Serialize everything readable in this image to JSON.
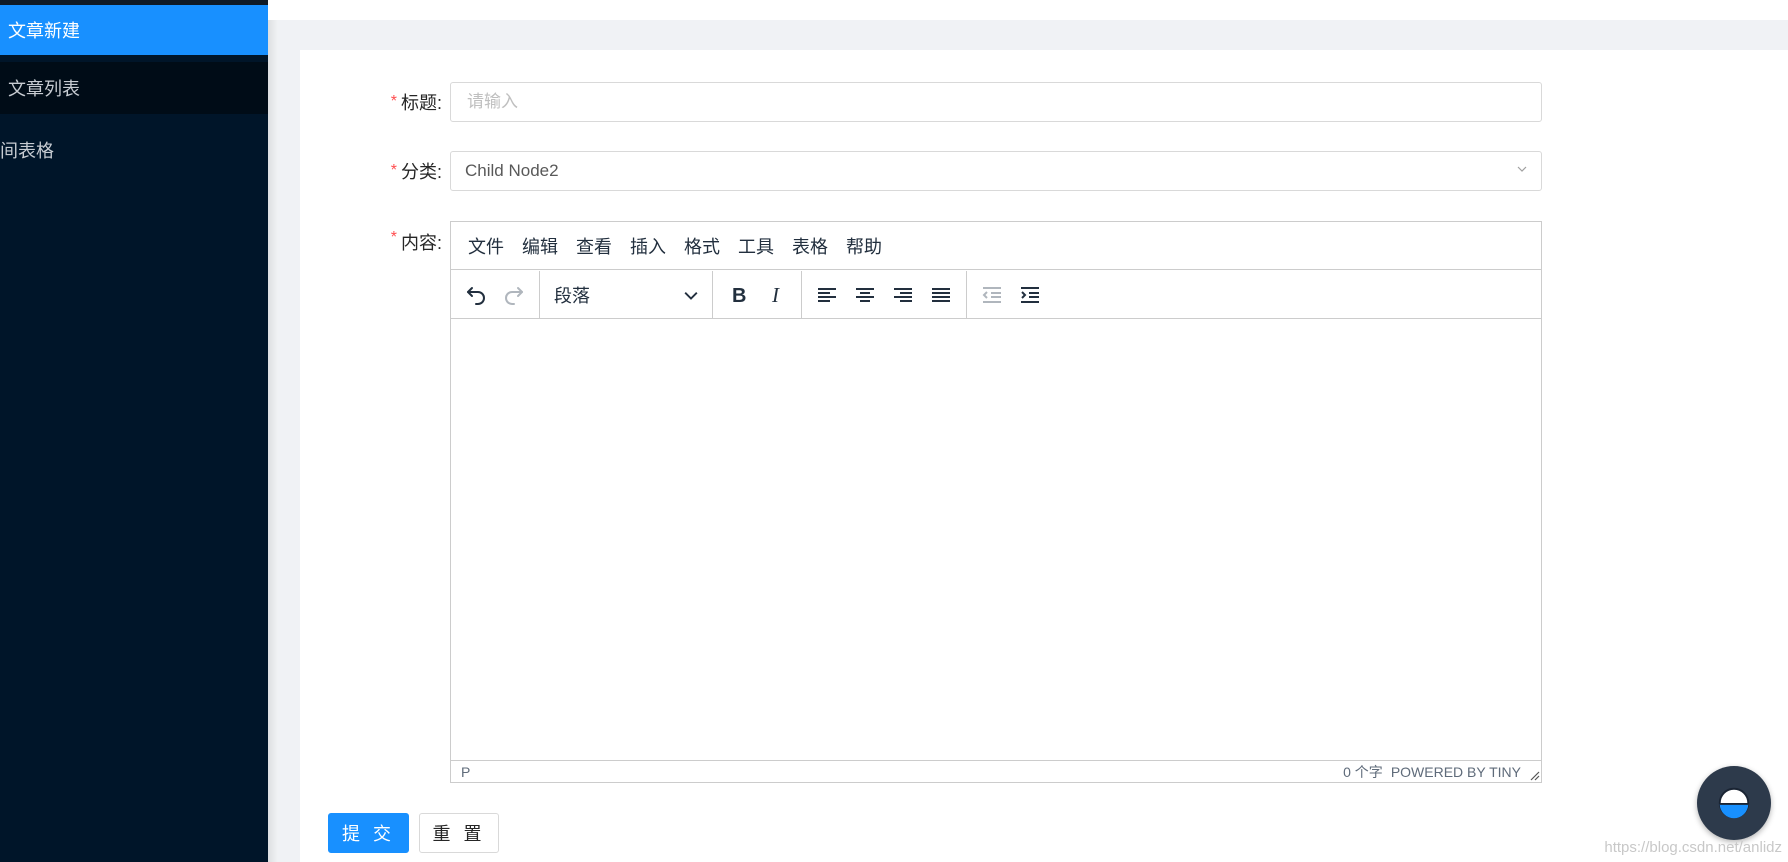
{
  "sidebar": {
    "items": [
      {
        "label": "文章新建",
        "active": true
      },
      {
        "label": "文章列表",
        "active": false
      },
      {
        "label": "间表格",
        "active": false
      }
    ]
  },
  "form": {
    "title": {
      "label": "标题:",
      "placeholder": "请输入",
      "value": ""
    },
    "category": {
      "label": "分类:",
      "value": "Child Node2"
    },
    "content": {
      "label": "内容:"
    }
  },
  "editor": {
    "menu": [
      "文件",
      "编辑",
      "查看",
      "插入",
      "格式",
      "工具",
      "表格",
      "帮助"
    ],
    "block_format": "段落",
    "status_path": "P",
    "word_count": "0 个字",
    "powered_by": "POWERED BY TINY"
  },
  "buttons": {
    "submit": "提 交",
    "reset": "重 置"
  },
  "watermark": "https://blog.csdn.net/anlidz",
  "colors": {
    "primary": "#1890ff",
    "sidebar_bg": "#001529",
    "required_star": "#ff4d4f"
  }
}
